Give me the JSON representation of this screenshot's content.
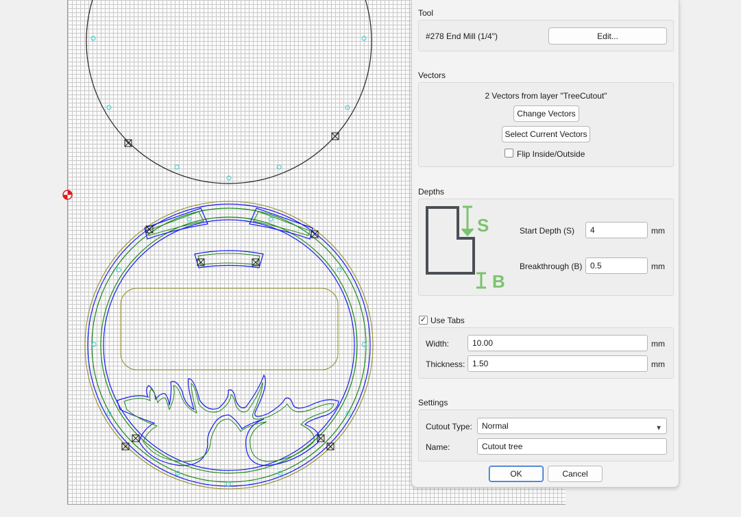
{
  "tool": {
    "section_title": "Tool",
    "name": "#278 End Mill (1/4\")",
    "edit_label": "Edit..."
  },
  "vectors": {
    "section_title": "Vectors",
    "summary": "2 Vectors from layer \"TreeCutout\"",
    "change_label": "Change Vectors",
    "select_label": "Select Current Vectors",
    "flip_label": "Flip Inside/Outside",
    "flip_checked": false
  },
  "depths": {
    "section_title": "Depths",
    "diagram_s": "S",
    "diagram_b": "B",
    "start_label": "Start Depth (S)",
    "start_value": "4",
    "breakthrough_label": "Breakthrough (B)",
    "breakthrough_value": "0.5",
    "unit": "mm"
  },
  "tabs": {
    "use_tabs_label": "Use Tabs",
    "use_tabs_checked": true,
    "width_label": "Width:",
    "width_value": "10.00",
    "thickness_label": "Thickness:",
    "thickness_value": "1.50",
    "unit": "mm"
  },
  "settings": {
    "section_title": "Settings",
    "cutout_type_label": "Cutout Type:",
    "cutout_type_value": "Normal",
    "name_label": "Name:",
    "name_value": "Cutout tree"
  },
  "buttons": {
    "ok_label": "OK",
    "cancel_label": "Cancel"
  },
  "colors": {
    "toolpath_blue": "#1a1aee",
    "toolpath_green": "#1a8a1a",
    "outline_olive": "#8c8c1e",
    "tab_marker_cyan": "#33cccc",
    "diagram_green": "#7cc36e",
    "diagram_dark": "#4a4f55",
    "origin_red": "#e01818"
  }
}
